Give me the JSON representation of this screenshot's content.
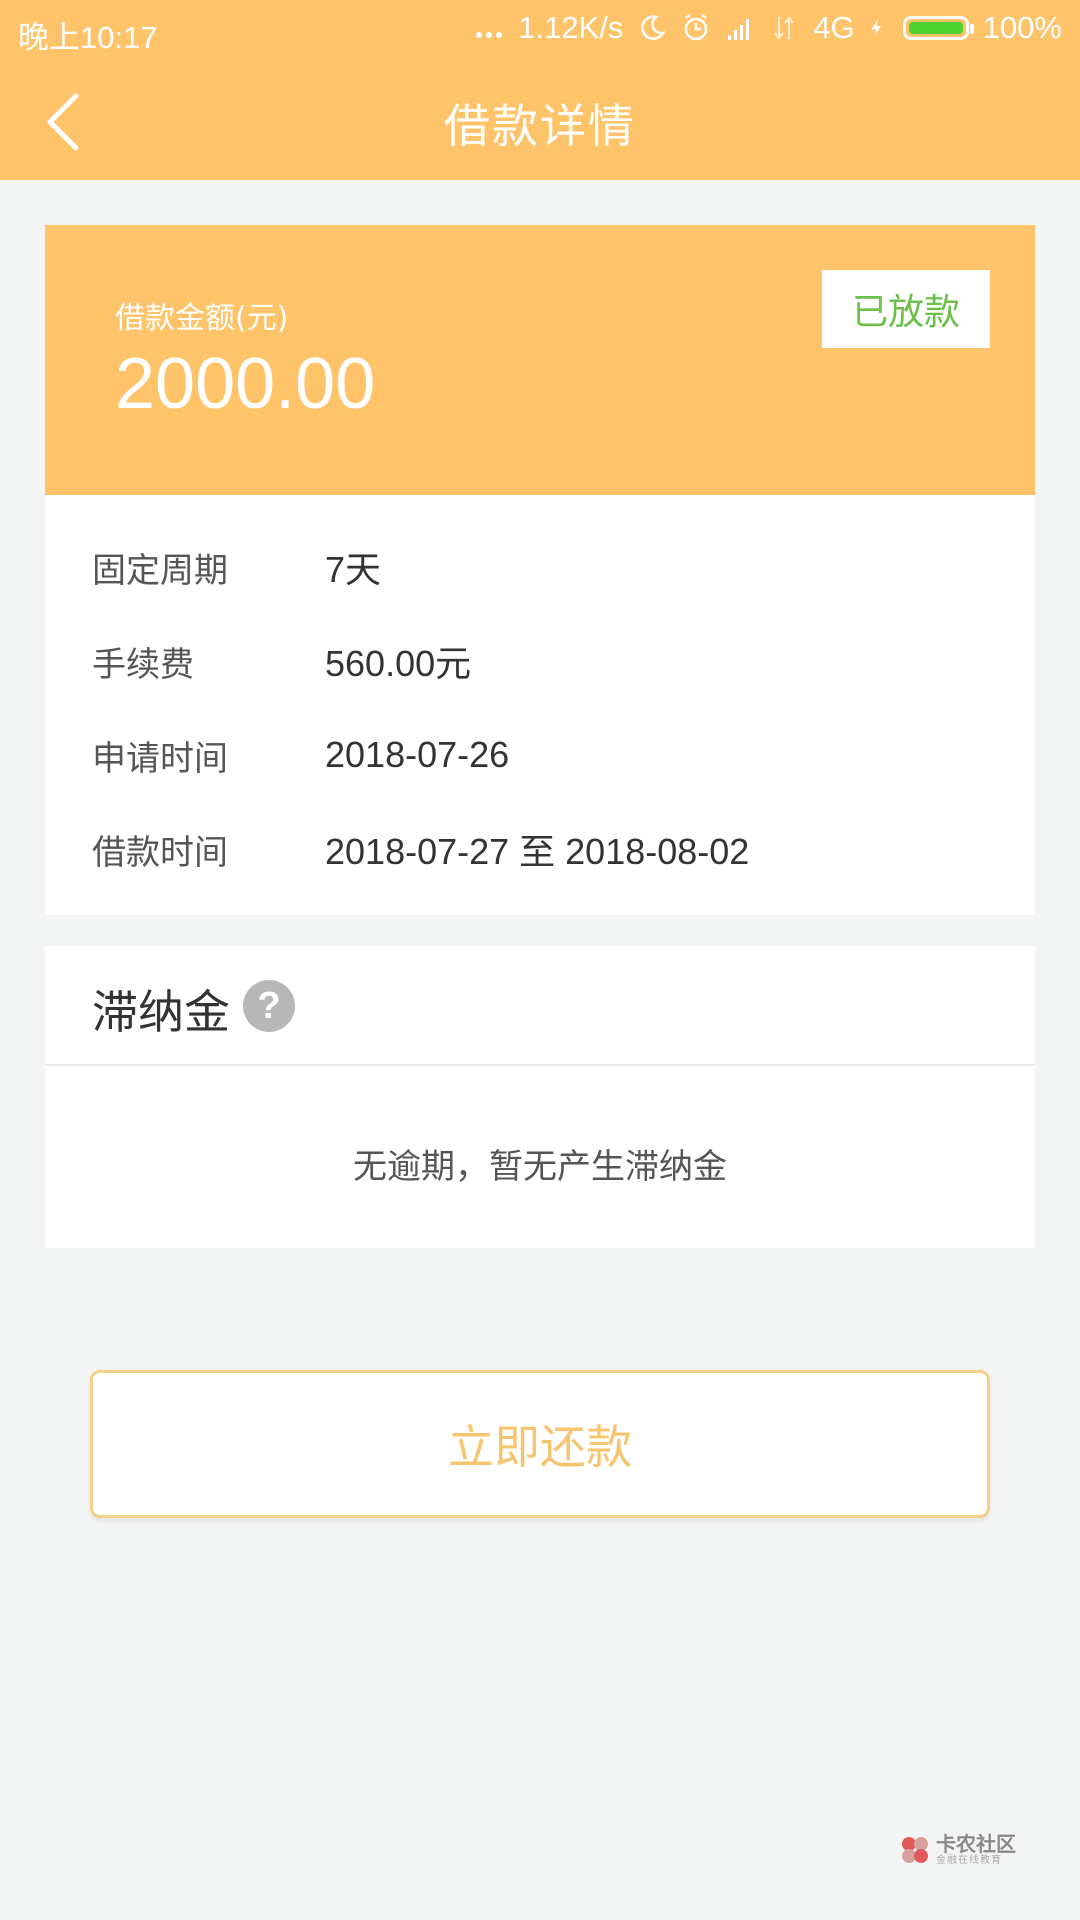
{
  "status_bar": {
    "time": "晚上10:17",
    "network_speed": "1.12K/s",
    "network_type": "4G",
    "battery": "100%",
    "icons": [
      "more-dots-icon",
      "moon-icon",
      "alarm-icon",
      "signal-icon",
      "data-arrows-icon",
      "charging-icon",
      "battery-icon"
    ]
  },
  "header": {
    "title": "借款详情",
    "back_icon": "back-chevron-icon"
  },
  "amount_card": {
    "label": "借款金额(元)",
    "amount": "2000.00",
    "status": "已放款"
  },
  "details": [
    {
      "label": "固定周期",
      "value": "7天"
    },
    {
      "label": "手续费",
      "value": "560.00元"
    },
    {
      "label": "申请时间",
      "value": "2018-07-26"
    },
    {
      "label": "借款时间",
      "value": "2018-07-27 至 2018-08-02"
    }
  ],
  "late_fee": {
    "title": "滞纳金",
    "help_icon": "?",
    "empty_text": "无逾期，暂无产生滞纳金"
  },
  "actions": {
    "repay_label": "立即还款"
  },
  "watermark": {
    "name": "卡农社区",
    "tagline": "金融在线教育"
  },
  "colors": {
    "brand": "#ffc46a",
    "status_green": "#6cc04a",
    "button_text": "#f7c46f",
    "background": "#f3f4f4"
  }
}
